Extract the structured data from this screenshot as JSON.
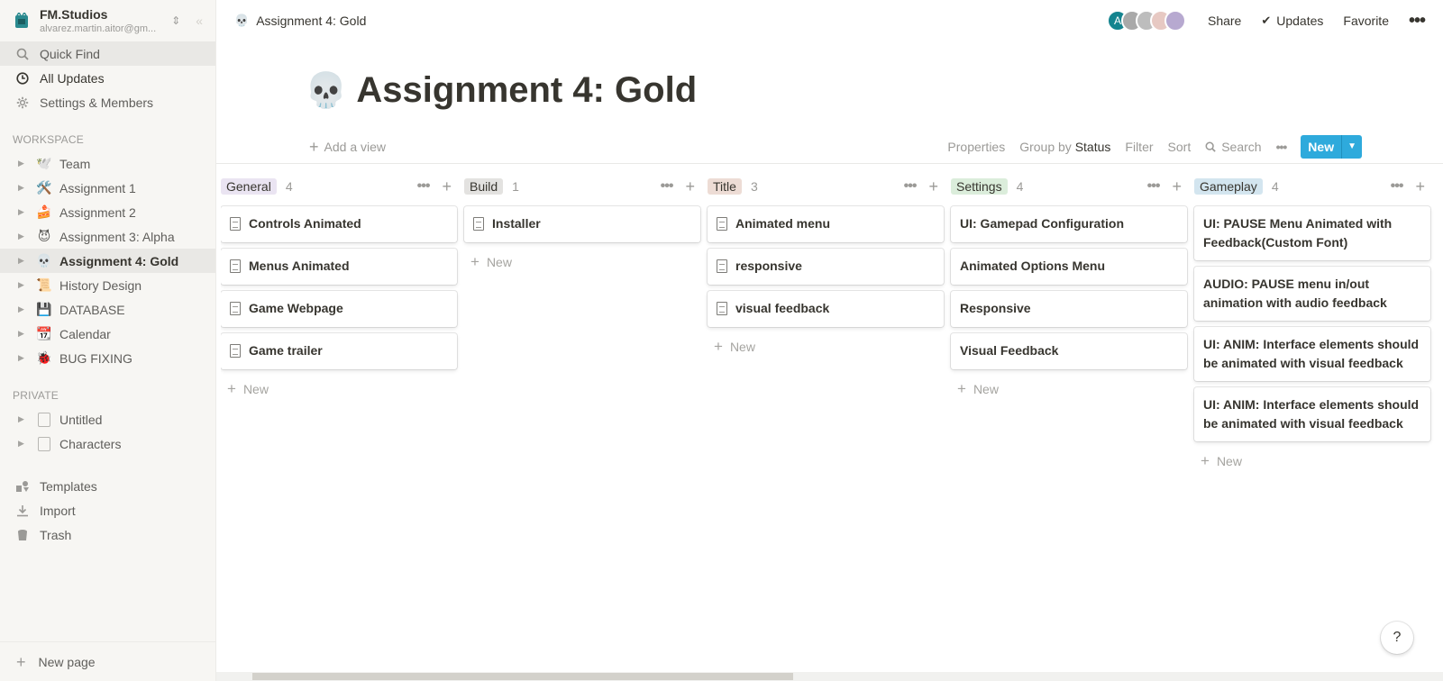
{
  "workspace": {
    "name": "FM.Studios",
    "email": "alvarez.martin.aitor@gm..."
  },
  "nav": [
    {
      "label": "Quick Find",
      "icon": "search-icon"
    },
    {
      "label": "All Updates",
      "icon": "clock-icon"
    },
    {
      "label": "Settings & Members",
      "icon": "gear-icon"
    }
  ],
  "sections": {
    "workspace": "WORKSPACE",
    "private": "PRIVATE"
  },
  "workspace_pages": [
    {
      "emoji": "🕊️",
      "label": "Team"
    },
    {
      "emoji": "🛠️",
      "label": "Assignment 1"
    },
    {
      "emoji": "🍰",
      "label": "Assignment 2"
    },
    {
      "emoji": "😈",
      "label": "Assignment 3: Alpha"
    },
    {
      "emoji": "💀",
      "label": "Assignment 4: Gold"
    },
    {
      "emoji": "📜",
      "label": "History Design"
    },
    {
      "emoji": "💾",
      "label": "DATABASE"
    },
    {
      "emoji": "📆",
      "label": "Calendar"
    },
    {
      "emoji": "🐞",
      "label": "BUG FIXING"
    }
  ],
  "private_pages": [
    {
      "label": "Untitled"
    },
    {
      "label": "Characters"
    }
  ],
  "bottom_nav": [
    {
      "label": "Templates",
      "icon": "templates-icon"
    },
    {
      "label": "Import",
      "icon": "import-icon"
    },
    {
      "label": "Trash",
      "icon": "trash-icon"
    }
  ],
  "new_page_label": "New page",
  "topbar": {
    "breadcrumb": "Assignment 4: Gold",
    "breadcrumb_emoji": "💀",
    "share": "Share",
    "updates": "Updates",
    "favorite": "Favorite",
    "avatar_initial": "A"
  },
  "page": {
    "emoji": "💀",
    "title": "Assignment 4: Gold"
  },
  "view_bar": {
    "add_view": "Add a view",
    "properties": "Properties",
    "group_by": "Group by",
    "group_value": "Status",
    "filter": "Filter",
    "sort": "Sort",
    "search": "Search",
    "new": "New"
  },
  "columns": [
    {
      "name": "General",
      "count": "4",
      "color": "#eae4f2",
      "cards": [
        "Controls Animated",
        "Menus Animated",
        "Game Webpage",
        "Game trailer"
      ],
      "doc": true
    },
    {
      "name": "Build",
      "count": "1",
      "color": "#e3e2e0",
      "cards": [
        "Installer"
      ],
      "doc": true
    },
    {
      "name": "Title",
      "count": "3",
      "color": "#eddcd5",
      "cards": [
        "Animated menu",
        "responsive",
        "visual feedback"
      ],
      "doc": true
    },
    {
      "name": "Settings",
      "count": "4",
      "color": "#dbeddb",
      "cards": [
        "UI: Gamepad Configuration",
        "Animated Options Menu",
        "Responsive",
        "Visual Feedback"
      ],
      "doc": false
    },
    {
      "name": "Gameplay",
      "count": "4",
      "color": "#d3e5ef",
      "cards": [
        "UI: PAUSE Menu Animated with Feedback(Custom Font)",
        "AUDIO: PAUSE menu in/out animation with audio feedback",
        "UI: ANIM: Interface elements should be animated with visual feedback",
        "UI: ANIM: Interface elements should be animated with visual feedback"
      ],
      "doc": false
    }
  ],
  "column_new_label": "New",
  "help": "?"
}
